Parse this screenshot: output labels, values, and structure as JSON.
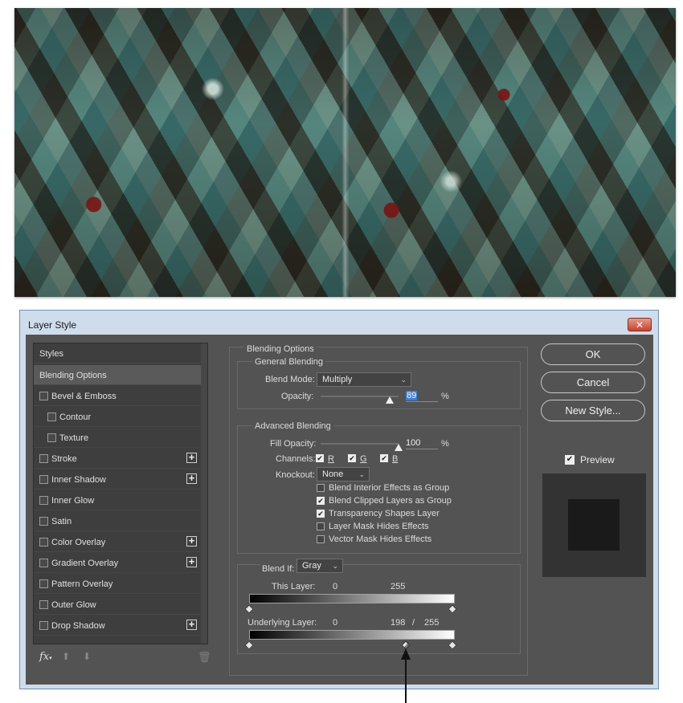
{
  "dialog": {
    "title": "Layer Style",
    "close_label": "✕"
  },
  "styles_panel": {
    "items": [
      {
        "label": "Styles",
        "checkbox": false,
        "plus": false,
        "selected": false
      },
      {
        "label": "Blending Options",
        "checkbox": false,
        "plus": false,
        "selected": true
      },
      {
        "label": "Bevel & Emboss",
        "checkbox": true,
        "plus": false,
        "selected": false
      },
      {
        "label": "Contour",
        "checkbox": true,
        "plus": false,
        "selected": false,
        "indent": true
      },
      {
        "label": "Texture",
        "checkbox": true,
        "plus": false,
        "selected": false,
        "indent": true
      },
      {
        "label": "Stroke",
        "checkbox": true,
        "plus": true,
        "selected": false
      },
      {
        "label": "Inner Shadow",
        "checkbox": true,
        "plus": true,
        "selected": false
      },
      {
        "label": "Inner Glow",
        "checkbox": true,
        "plus": false,
        "selected": false
      },
      {
        "label": "Satin",
        "checkbox": true,
        "plus": false,
        "selected": false
      },
      {
        "label": "Color Overlay",
        "checkbox": true,
        "plus": true,
        "selected": false
      },
      {
        "label": "Gradient Overlay",
        "checkbox": true,
        "plus": true,
        "selected": false
      },
      {
        "label": "Pattern Overlay",
        "checkbox": true,
        "plus": false,
        "selected": false
      },
      {
        "label": "Outer Glow",
        "checkbox": true,
        "plus": false,
        "selected": false
      },
      {
        "label": "Drop Shadow",
        "checkbox": true,
        "plus": true,
        "selected": false
      }
    ],
    "footer": {
      "fx": "fx",
      "fx_caret": "▾",
      "up": "⬆",
      "down": "⬇",
      "trash": "🗑"
    }
  },
  "blending_options": {
    "title": "Blending Options",
    "general": {
      "title": "General Blending",
      "blend_mode_label": "Blend Mode:",
      "blend_mode_value": "Multiply",
      "opacity_label": "Opacity:",
      "opacity_value": "89",
      "opacity_fraction": 0.89,
      "percent": "%"
    },
    "advanced": {
      "title": "Advanced Blending",
      "fill_opacity_label": "Fill Opacity:",
      "fill_opacity_value": "100",
      "fill_fraction": 1.0,
      "percent": "%",
      "channels_label": "Channels:",
      "channels": [
        {
          "label": "R",
          "checked": true
        },
        {
          "label": "G",
          "checked": true
        },
        {
          "label": "B",
          "checked": true
        }
      ],
      "knockout_label": "Knockout:",
      "knockout_value": "None",
      "options": [
        {
          "label": "Blend Interior Effects as Group",
          "checked": false
        },
        {
          "label": "Blend Clipped Layers as Group",
          "checked": true
        },
        {
          "label": "Transparency Shapes Layer",
          "checked": true
        },
        {
          "label": "Layer Mask Hides Effects",
          "checked": false
        },
        {
          "label": "Vector Mask Hides Effects",
          "checked": false
        }
      ]
    },
    "blend_if": {
      "label": "Blend If:",
      "value": "Gray",
      "this_layer_label": "This Layer:",
      "this_layer_min": "0",
      "this_layer_max": "255",
      "underlying_label": "Underlying Layer:",
      "underlying_min": "0",
      "underlying_split": "198",
      "slash": "/",
      "underlying_max": "255"
    }
  },
  "buttons": {
    "ok": "OK",
    "cancel": "Cancel",
    "new_style": "New Style...",
    "preview_label": "Preview",
    "preview_checked": true
  },
  "colors": {
    "dialog_frame": "#cfdcec",
    "panel_bg": "#535353",
    "close_red": "#c5432e"
  }
}
